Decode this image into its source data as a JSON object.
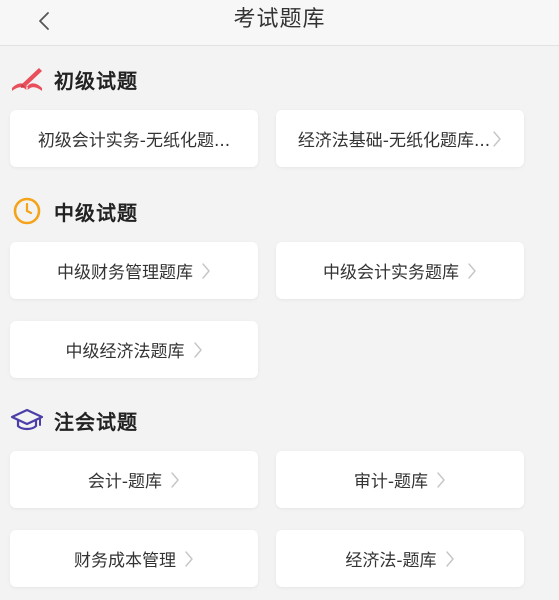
{
  "header": {
    "title": "考试题库"
  },
  "sections": [
    {
      "title": "初级试题",
      "items": [
        {
          "label": "初级会计实务-无纸化题..."
        },
        {
          "label": "经济法基础-无纸化题库..."
        }
      ]
    },
    {
      "title": "中级试题",
      "items": [
        {
          "label": "中级财务管理题库"
        },
        {
          "label": "中级会计实务题库"
        },
        {
          "label": "中级经济法题库"
        }
      ]
    },
    {
      "title": "注会试题",
      "items": [
        {
          "label": "会计-题库"
        },
        {
          "label": "审计-题库"
        },
        {
          "label": "财务成本管理"
        },
        {
          "label": "经济法-题库"
        }
      ]
    }
  ],
  "colors": {
    "primary_icon": "#e84f5a",
    "intermediate_icon": "#f4a31a",
    "cpa_icon": "#4b3ea8"
  }
}
